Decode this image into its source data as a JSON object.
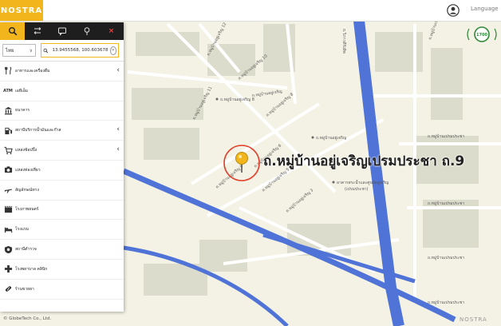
{
  "header": {
    "logo_text": "NOSTRA",
    "language_label": "Language"
  },
  "toolbar": {
    "close_label": "×"
  },
  "search": {
    "language_value": "ไทย",
    "coordinates_value": "13.9455568, 100.603678"
  },
  "categories": [
    {
      "label": "อาหารและเครื่องดื่ม",
      "icon": "fork-knife-icon",
      "expandable": true
    },
    {
      "label": "เอทีเอ็ม",
      "icon": "atm-icon",
      "expandable": false
    },
    {
      "label": "ธนาคาร",
      "icon": "bank-icon",
      "expandable": false
    },
    {
      "label": "สถานีบริการน้ำมันและก๊าส",
      "icon": "fuel-pump-icon",
      "expandable": true
    },
    {
      "label": "แหล่งช้อปปิ้ง",
      "icon": "shopping-cart-icon",
      "expandable": true
    },
    {
      "label": "แหล่งท่องเที่ยว",
      "icon": "camera-icon",
      "expandable": false
    },
    {
      "label": "สัญลักษณ์ทาง",
      "icon": "airplane-icon",
      "expandable": false
    },
    {
      "label": "โรงภาพยนตร์",
      "icon": "film-icon",
      "expandable": false
    },
    {
      "label": "โรงแรม",
      "icon": "bed-icon",
      "expandable": false
    },
    {
      "label": "สถานีตำรวจ",
      "icon": "police-icon",
      "expandable": false
    },
    {
      "label": "โรงพยาบาล คลินิก",
      "icon": "hospital-cross-icon",
      "expandable": false
    },
    {
      "label": "ร้านขายยา",
      "icon": "pill-icon",
      "expandable": false
    }
  ],
  "map": {
    "place_label": "ถ.หมู่บ้านอยู่เจริญเปรมประชา ถ.9",
    "badge_text": "1700",
    "roads": [
      {
        "label": "ถ.หมู่บ้านอยู่เจริญ 12"
      },
      {
        "label": "ถ.หมู่บ้านอยู่เจริญ 10"
      },
      {
        "label": "ถ.หมู่บ้านอยู่เจริญ 11"
      },
      {
        "label": "ถ.หมู่บ้านอยู่เจริญ 8"
      },
      {
        "label": "ถ.หมู่บ้านอยู่เจริญ 6"
      },
      {
        "label": "ถ.หมู่บ้านอยู่เจริญ 5"
      },
      {
        "label": "ถ.หมู่บ้านอยู่เจริญ 3"
      },
      {
        "label": "ถ.หมู่บ้านอยู่เจริญ 9"
      },
      {
        "label": "ถ.หมู่บ้านอยู่เจริญ"
      },
      {
        "label": "ถ.หมู่บ้านเปรมประชา"
      },
      {
        "label": "ถ.หมู่บ้านเปรมประชา"
      },
      {
        "label": "ถ.หมู่บ้านเปรมประชา"
      },
      {
        "label": "ถ.หมู่บ้านเปรมประชา"
      },
      {
        "label": "ถ.หมู่บ้านเปรมประชา"
      },
      {
        "label": "ถ.วิภาวดีรังสิต"
      }
    ],
    "pois": [
      {
        "label": "ถ.หมู่บ้านอยู่เจริญ 8"
      },
      {
        "label": "ถ.หมู่บ้านอยู่เจริญ"
      },
      {
        "label": "อาคารสระน้ำและศูนย์อยู่เจริญ"
      },
      {
        "label": "(เปรมประชา)"
      }
    ]
  },
  "footer": {
    "copyright": "© GlobeTech Co., Ltd.",
    "brand": "NOSTRA"
  },
  "colors": {
    "accent": "#f2b61c",
    "water": "#4f73d6",
    "land": "#f4f2e4",
    "block": "#dcdccc",
    "pin_ring": "#e0402c"
  }
}
